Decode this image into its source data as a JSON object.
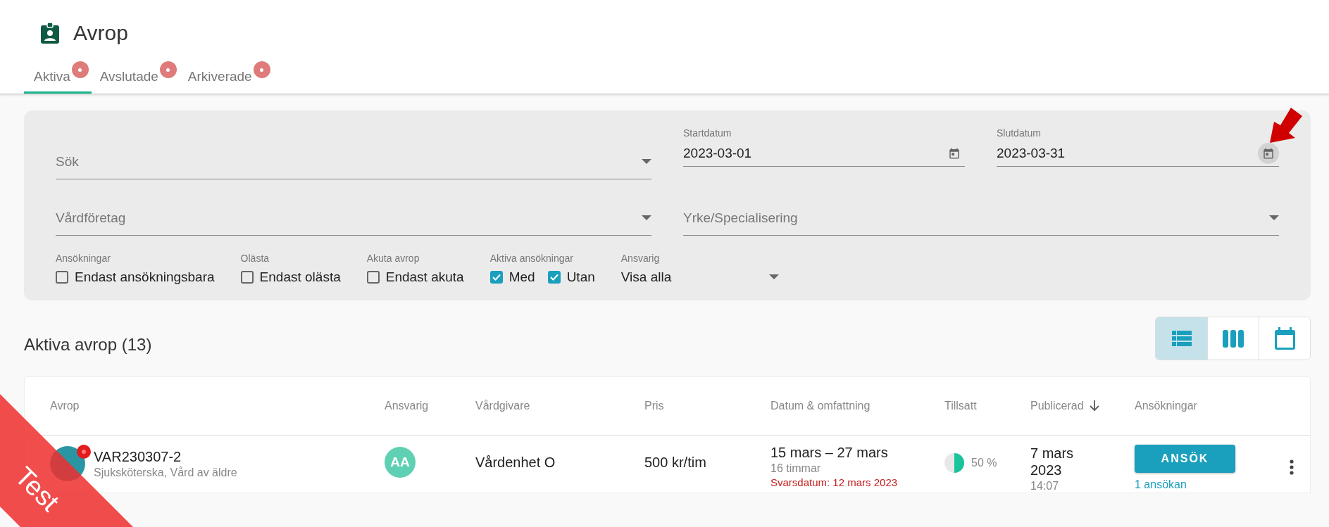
{
  "header": {
    "title": "Avrop"
  },
  "tabs": [
    {
      "label": "Aktiva",
      "selected": true,
      "badge": true
    },
    {
      "label": "Avslutade",
      "selected": false,
      "badge": true
    },
    {
      "label": "Arkiverade",
      "selected": false,
      "badge": true
    }
  ],
  "filters": {
    "search": {
      "placeholder": "Sök"
    },
    "start_date": {
      "label": "Startdatum",
      "value": "2023-03-01"
    },
    "end_date": {
      "label": "Slutdatum",
      "value": "2023-03-31"
    },
    "company": {
      "placeholder": "Vårdföretag"
    },
    "profession": {
      "placeholder": "Yrke/Specialisering"
    },
    "groups": [
      {
        "label": "Ansökningar",
        "options": [
          {
            "label": "Endast ansökningsbara",
            "checked": false
          }
        ]
      },
      {
        "label": "Olästa",
        "options": [
          {
            "label": "Endast olästa",
            "checked": false
          }
        ]
      },
      {
        "label": "Akuta avrop",
        "options": [
          {
            "label": "Endast akuta",
            "checked": false
          }
        ]
      },
      {
        "label": "Aktiva ansökningar",
        "options": [
          {
            "label": "Med",
            "checked": true
          },
          {
            "label": "Utan",
            "checked": true
          }
        ]
      }
    ],
    "responsible": {
      "label": "Ansvarig",
      "value": "Visa alla"
    }
  },
  "list": {
    "title": "Aktiva avrop (13)",
    "views": [
      {
        "kind": "list",
        "selected": true
      },
      {
        "kind": "columns",
        "selected": false
      },
      {
        "kind": "calendar",
        "selected": false
      }
    ]
  },
  "table": {
    "columns": [
      {
        "label": "Avrop"
      },
      {
        "label": "Ansvarig"
      },
      {
        "label": "Vårdgivare"
      },
      {
        "label": "Pris"
      },
      {
        "label": "Datum & omfattning"
      },
      {
        "label": "Tillsatt"
      },
      {
        "label": "Publicerad",
        "sorted": true
      },
      {
        "label": "Ansökningar"
      }
    ],
    "rows": [
      {
        "unread": true,
        "id": "VAR230307-2",
        "subtitle": "Sjuksköterska, Vård av äldre",
        "responsible": "AA",
        "provider": "Vårdenhet O",
        "price": "500 kr/tim",
        "dates": "15 mars – 27 mars",
        "hours": "16 timmar",
        "deadline": "Svarsdatum: 12 mars 2023",
        "filled": "50 %",
        "level": 0.5,
        "published": "7 mars 2023",
        "time": "14:07",
        "action": "ANSÖK",
        "applications": "1 ansökan"
      }
    ]
  },
  "ribbon": {
    "label": "Test"
  }
}
